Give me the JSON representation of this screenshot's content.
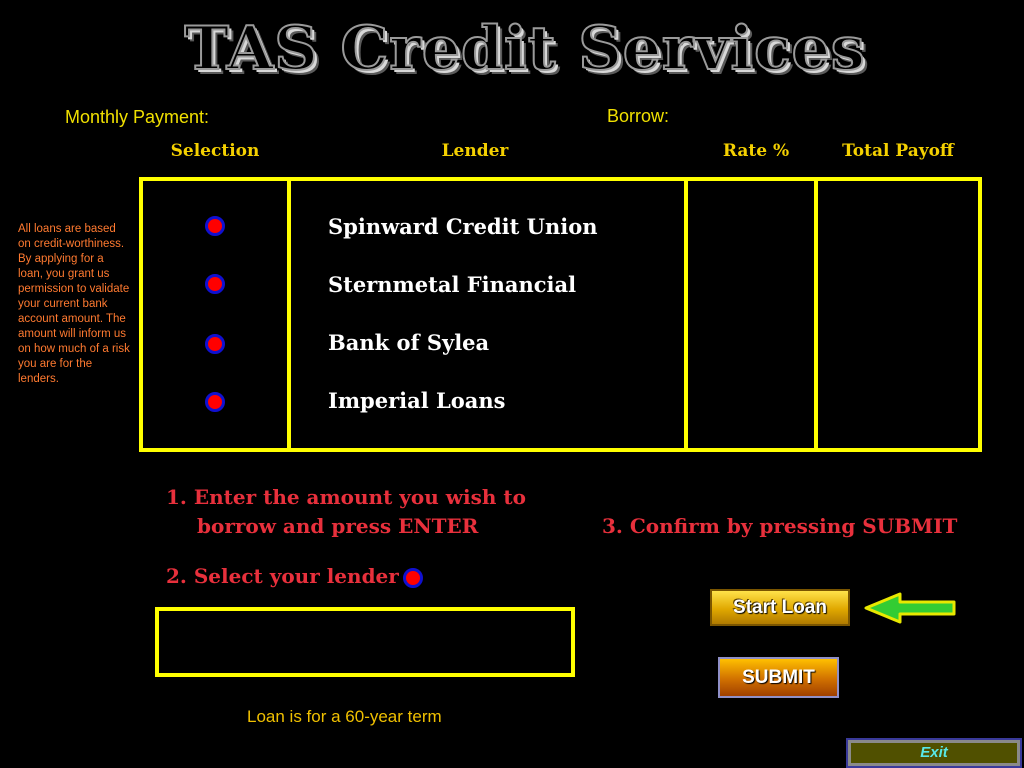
{
  "app": {
    "title": "TAS Credit Services"
  },
  "summary": {
    "monthly_payment_label": "Monthly Payment:",
    "borrow_label": "Borrow:"
  },
  "table": {
    "headers": {
      "selection": "Selection",
      "lender": "Lender",
      "rate": "Rate %",
      "total_payoff": "Total Payoff"
    },
    "lenders": [
      {
        "name": "Spinward Credit Union"
      },
      {
        "name": "Sternmetal Financial"
      },
      {
        "name": "Bank of Sylea"
      },
      {
        "name": "Imperial Loans"
      }
    ]
  },
  "disclaimer": "All loans are based on credit-worthiness. By applying for a loan, you grant us permission to validate your current bank account amount. The amount will inform us on how much of a risk you are for the lenders.",
  "instructions": {
    "step1_line1": "1.  Enter the amount you wish to",
    "step1_line2": "borrow and press ENTER",
    "step2": "2.  Select your lender",
    "step3": "3.  Confirm by pressing SUBMIT"
  },
  "amount_input": {
    "value": ""
  },
  "term_note": "Loan is for a 60-year term",
  "buttons": {
    "start_loan": "Start Loan",
    "submit": "SUBMIT",
    "exit": "Exit"
  },
  "colors": {
    "frame": "#ffff00",
    "radio_fill": "#ff0000",
    "radio_ring": "#1010d0",
    "step_text": "#e8303c",
    "arrow": "#33cc33"
  }
}
